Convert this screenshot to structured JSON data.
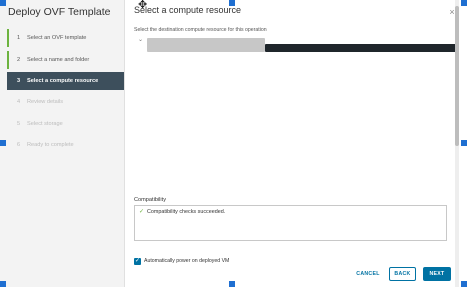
{
  "nav": {
    "title": "Deploy OVF Template",
    "steps": [
      {
        "num": "1",
        "label": "Select an OVF template",
        "state": "done"
      },
      {
        "num": "2",
        "label": "Select a name and folder",
        "state": "done"
      },
      {
        "num": "3",
        "label": "Select a compute resource",
        "state": "active"
      },
      {
        "num": "4",
        "label": "Review details",
        "state": "pending"
      },
      {
        "num": "5",
        "label": "Select storage",
        "state": "pending"
      },
      {
        "num": "6",
        "label": "Ready to complete",
        "state": "pending"
      }
    ]
  },
  "main": {
    "title": "Select a compute resource",
    "close_glyph": "×",
    "subtitle": "Select the destination compute resource for this operation",
    "tree_caret": "⌄",
    "compatibility": {
      "label": "Compatibility",
      "message": "Compatibility checks succeeded.",
      "check_glyph": "✓"
    },
    "power_on": {
      "label": "Automatically power on deployed VM",
      "checked": true
    }
  },
  "footer": {
    "cancel": "CANCEL",
    "back": "BACK",
    "next": "NEXT"
  },
  "colors": {
    "accent": "#0072a3",
    "active_step": "#3d4f5c",
    "done_marker": "#6db33f",
    "selection_handle": "#1f6fd1"
  }
}
